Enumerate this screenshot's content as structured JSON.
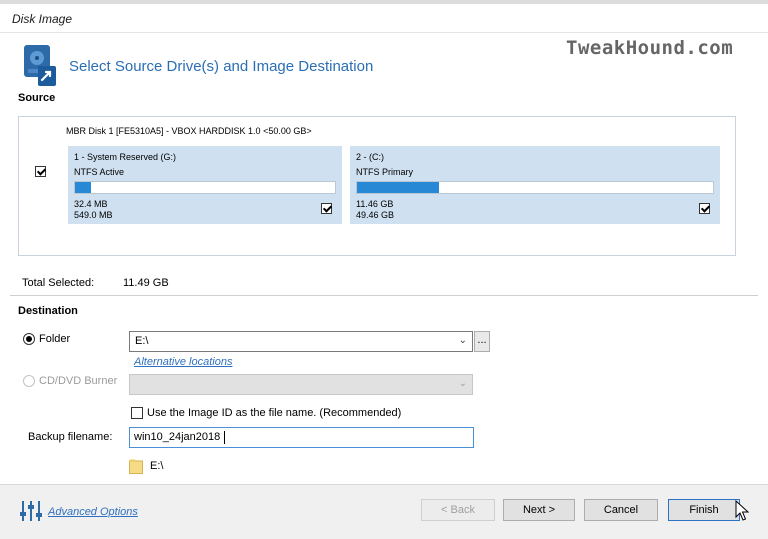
{
  "window": {
    "title": "Disk Image"
  },
  "header": {
    "title": "Select Source Drive(s) and Image Destination",
    "watermark": "TweakHound.com",
    "icon": "disk-image-wizard-icon"
  },
  "source": {
    "section_label": "Source",
    "disk_label": "MBR Disk 1 [FE5310A5] - VBOX HARDDISK 1.0  <50.00 GB>",
    "disk_checked": true,
    "partitions": [
      {
        "name": "1 - System Reserved (G:)",
        "fs": "NTFS Active",
        "used": "32.4 MB",
        "total": "549.0 MB",
        "usage_fraction": 0.06,
        "checked": true
      },
      {
        "name": "2 -  (C:)",
        "fs": "NTFS Primary",
        "used": "11.46 GB",
        "total": "49.46 GB",
        "usage_fraction": 0.23,
        "checked": true
      }
    ],
    "total_selected_label": "Total Selected:",
    "total_selected_value": "11.49 GB"
  },
  "destination": {
    "section_label": "Destination",
    "folder_label": "Folder",
    "folder_selected": true,
    "folder_value": "E:\\",
    "browse_label": "...",
    "alternative_locations_label": "Alternative locations",
    "dvd_label": "CD/DVD Burner",
    "dvd_value": "",
    "use_image_id_label": "Use the Image ID as the file name.  (Recommended)",
    "use_image_id_checked": false,
    "backup_filename_label": "Backup filename:",
    "backup_filename_value": "win10_24jan2018",
    "path_preview": "E:\\"
  },
  "footer": {
    "advanced_options_label": "Advanced Options",
    "back_label": "< Back",
    "next_label": "Next >",
    "cancel_label": "Cancel",
    "finish_label": "Finish"
  },
  "colors": {
    "accent": "#2a6fb5",
    "bar_fill": "#2789d6",
    "partition_bg": "#cfe0f0",
    "link": "#2f6fbf"
  }
}
